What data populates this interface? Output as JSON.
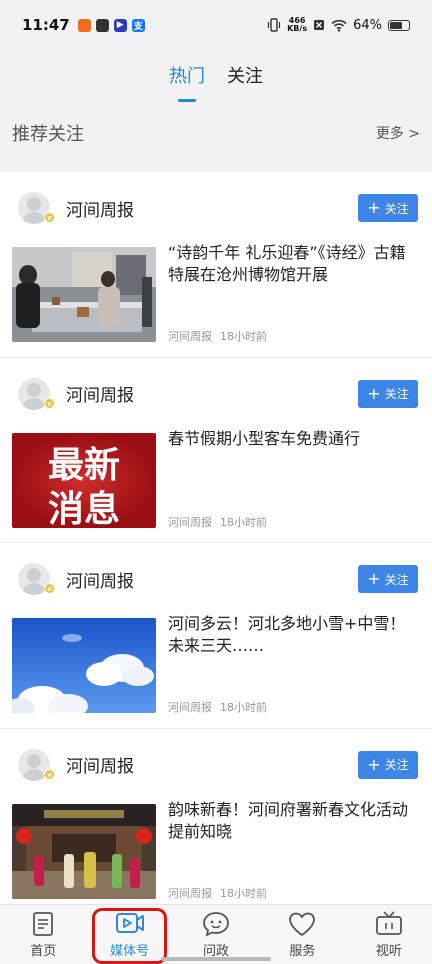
{
  "status_bar": {
    "time": "11:47",
    "net_speed_value": "466",
    "net_speed_unit": "KB/s",
    "battery": "64%",
    "app_icons": [
      "app-icon-orange",
      "app-icon-dark",
      "app-icon-blue-play",
      "app-icon-blue-alipay"
    ]
  },
  "tabs": [
    {
      "label": "热门",
      "active": true
    },
    {
      "label": "关注",
      "active": false
    }
  ],
  "recommend": {
    "title": "推荐关注",
    "more": "更多 >"
  },
  "feed": [
    {
      "author": "河间周报",
      "follow_label": "关注",
      "headline": "“诗韵千年 礼乐迎春”《诗经》古籍特展在沧州博物馆开展",
      "source": "河间周报",
      "time": "18小时前",
      "thumb": "museum-exhibition-photo"
    },
    {
      "author": "河间周报",
      "follow_label": "关注",
      "headline": "春节假期小型客车免费通行",
      "source": "河间周报",
      "time": "18小时前",
      "thumb": "latest-news-banner",
      "thumb_text": [
        "最新",
        "消息"
      ]
    },
    {
      "author": "河间周报",
      "follow_label": "关注",
      "headline": "河间多云！河北多地小雪+中雪！未来三天……",
      "source": "河间周报",
      "time": "18小时前",
      "thumb": "blue-sky-clouds-photo"
    },
    {
      "author": "河间周报",
      "follow_label": "关注",
      "headline": "韵味新春！河间府署新春文化活动提前知晓",
      "source": "河间周报",
      "time": "18小时前",
      "thumb": "new-year-performance-photo"
    }
  ],
  "bottom_nav": [
    {
      "label": "首页",
      "icon": "document-icon",
      "active": false
    },
    {
      "label": "媒体号",
      "icon": "video-play-icon",
      "active": true
    },
    {
      "label": "问政",
      "icon": "chat-bubble-icon",
      "active": false
    },
    {
      "label": "服务",
      "icon": "heart-icon",
      "active": false
    },
    {
      "label": "视听",
      "icon": "tv-icon",
      "active": false
    }
  ],
  "colors": {
    "accent": "#1b8ad8",
    "follow_button": "#3d86e8",
    "highlight_box": "#e01313",
    "banner_red": "#b4161b"
  }
}
